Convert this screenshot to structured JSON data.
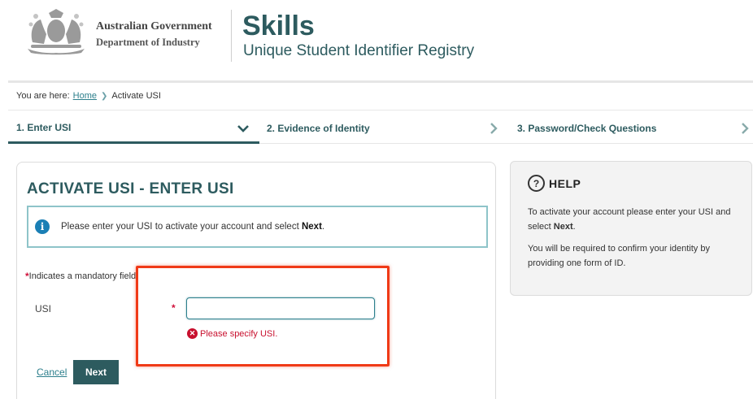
{
  "header": {
    "gov_line1": "Australian Government",
    "gov_line2": "Department of Industry",
    "title": "Skills",
    "subtitle": "Unique Student Identifier Registry"
  },
  "breadcrumb": {
    "prefix": "You are here:",
    "home": "Home",
    "current": "Activate USI"
  },
  "steps": [
    {
      "label": "1. Enter USI",
      "state": "active",
      "icon": "chevron-down-icon"
    },
    {
      "label": "2. Evidence of Identity",
      "state": "inactive",
      "icon": "chevron-right-icon"
    },
    {
      "label": "3. Password/Check Questions",
      "state": "inactive",
      "icon": "chevron-right-icon"
    }
  ],
  "main": {
    "title": "ACTIVATE USI - ENTER USI",
    "info_text_before": "Please enter your USI to activate your account and select ",
    "info_text_bold": "Next",
    "info_text_after": ".",
    "mandatory_note": "Indicates a mandatory field",
    "usi_label": "USI",
    "usi_value": "",
    "usi_placeholder": "",
    "error_text": "Please specify USI.",
    "cancel_label": "Cancel",
    "next_label": "Next"
  },
  "help": {
    "title": "HELP",
    "p1_before": "To activate your account please enter your USI and select ",
    "p1_bold": "Next",
    "p1_after": ".",
    "p2": "You will be required to confirm your identity by providing one form of ID."
  },
  "colors": {
    "brand": "#2d5b5f",
    "link": "#2d7f8c",
    "error": "#c8102e",
    "highlight": "#f03a17",
    "info_icon": "#1a7fb5"
  }
}
